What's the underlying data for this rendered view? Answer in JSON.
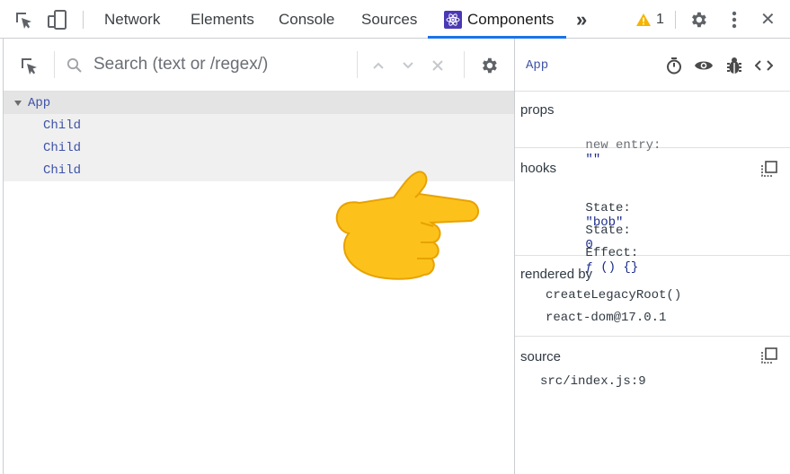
{
  "toolbar": {
    "tabs": [
      {
        "label": "Network"
      },
      {
        "label": "Elements"
      },
      {
        "label": "Console"
      },
      {
        "label": "Sources"
      },
      {
        "label": "Components"
      }
    ],
    "more_label": "»",
    "warning_count": "1",
    "close_label": "✕"
  },
  "search": {
    "placeholder": "Search (text or /regex/)"
  },
  "tree": {
    "root": "App",
    "children": [
      "Child",
      "Child",
      "Child"
    ]
  },
  "inspector": {
    "title": "App",
    "props": {
      "title": "props",
      "new_entry_key": "new entry:",
      "new_entry_value": "\"\""
    },
    "hooks": {
      "title": "hooks",
      "items": [
        {
          "key": "State:",
          "value": "\"bob\""
        },
        {
          "key": "State:",
          "value": "0"
        },
        {
          "key": "Effect:",
          "value": "ƒ () {}"
        }
      ]
    },
    "rendered_by": {
      "title": "rendered by",
      "items": [
        "createLegacyRoot()",
        "react-dom@17.0.1"
      ]
    },
    "source": {
      "title": "source",
      "value": "src/index.js:9"
    }
  },
  "colors": {
    "accent": "#1a73e8",
    "component_name": "#3d52a7",
    "warning": "#f4b400",
    "emoji": "#fcc21b"
  },
  "icons": [
    "cursor-select-icon",
    "device-toggle-icon",
    "react-logo-icon",
    "warning-icon",
    "gear-icon",
    "kebab-menu-icon",
    "close-icon",
    "search-icon",
    "chevron-up-icon",
    "chevron-down-icon",
    "clear-icon",
    "stopwatch-icon",
    "eye-icon",
    "bug-icon",
    "code-icon",
    "copy-icon",
    "pointing-hand-emoji"
  ]
}
